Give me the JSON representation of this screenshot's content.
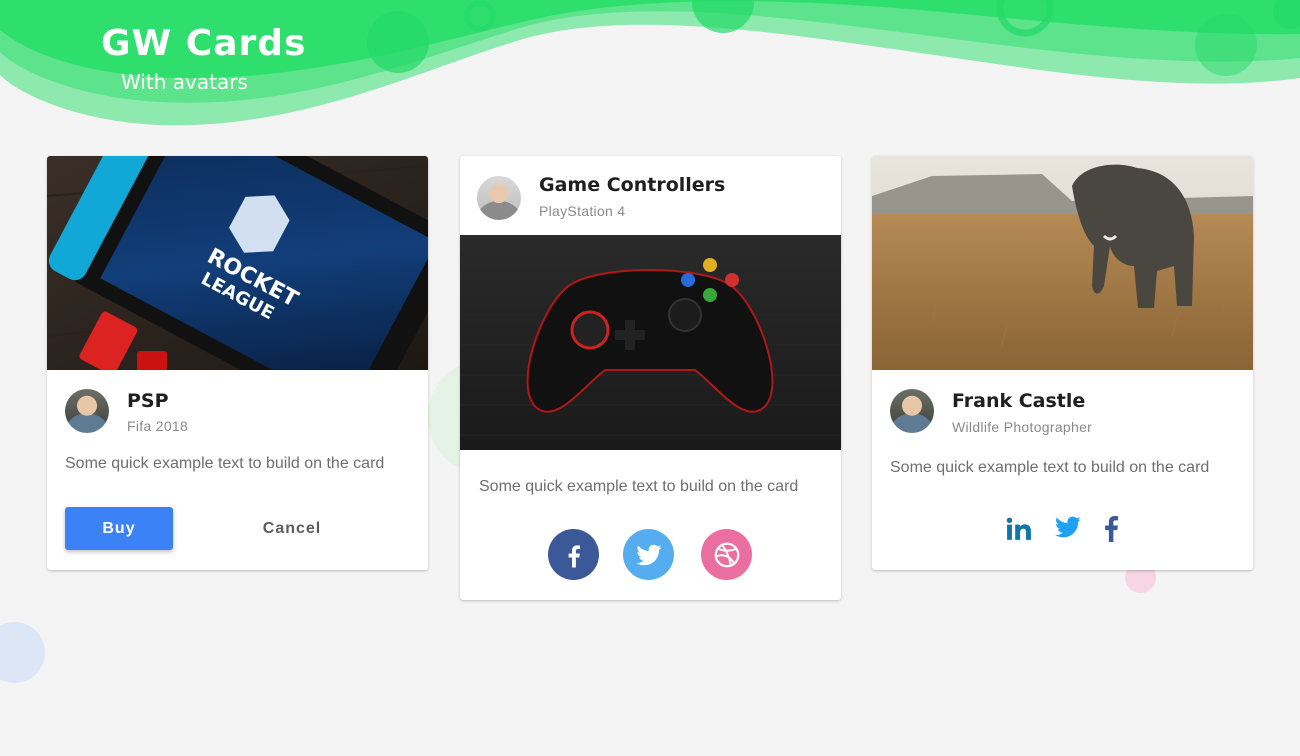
{
  "header": {
    "title": "GW Cards",
    "subtitle": "With avatars",
    "colors": {
      "primary": "#2fe06f",
      "light": "#8ee9ae"
    }
  },
  "cards": [
    {
      "image": "rocket-league-switch-photo",
      "avatar": "man-avatar",
      "title": "PSP",
      "subtitle": "Fifa 2018",
      "text": "Some quick example text to build on the card",
      "actions": {
        "primary": "Buy",
        "secondary": "Cancel"
      },
      "primary_color": "#3b82f6"
    },
    {
      "avatar": "man-smiling-avatar",
      "title": "Game Controllers",
      "subtitle": "PlayStation 4",
      "image": "gamepad-photo",
      "text": "Some quick example text to build on the card",
      "social": [
        {
          "icon": "facebook-icon",
          "color": "#3b5998"
        },
        {
          "icon": "twitter-icon",
          "color": "#55acee"
        },
        {
          "icon": "dribbble-icon",
          "color": "#ea6fa0"
        }
      ]
    },
    {
      "image": "elephant-savanna-photo",
      "avatar": "man-avatar",
      "title": "Frank Castle",
      "subtitle": "Wildlife Photographer",
      "text": "Some quick example text to build on the card",
      "social": [
        {
          "icon": "linkedin-icon",
          "color": "#0e76a8"
        },
        {
          "icon": "twitter-icon",
          "color": "#1da1f2"
        },
        {
          "icon": "facebook-icon",
          "color": "#3b5998"
        }
      ]
    }
  ]
}
